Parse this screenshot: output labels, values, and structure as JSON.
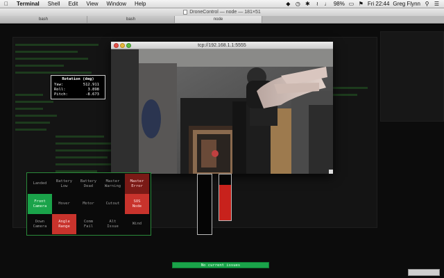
{
  "menubar": {
    "app": "Terminal",
    "items": [
      "Shell",
      "Edit",
      "View",
      "Window",
      "Help"
    ],
    "battery": "98%",
    "clock": "Fri 22:44",
    "user": "Greg Flynn"
  },
  "terminal": {
    "title": "DroneControl — node — 181×51",
    "tabs": [
      "bash",
      "bash",
      "node"
    ],
    "active_tab": 2
  },
  "camera": {
    "window_title": "tcp://192.168.1.1:5555"
  },
  "rotation": {
    "title": "Rotation (deg)",
    "yaw_label": "Yaw:",
    "yaw": "512.911",
    "roll_label": "Roll:",
    "roll": "3.898",
    "pitch_label": "Pitch:",
    "pitch": "-8.673"
  },
  "status_cells": [
    {
      "line1": "Landed",
      "line2": "",
      "state": "off"
    },
    {
      "line1": "Battery",
      "line2": "Low",
      "state": "off"
    },
    {
      "line1": "Battery",
      "line2": "Dead",
      "state": "off"
    },
    {
      "line1": "Master",
      "line2": "Warning",
      "state": "off"
    },
    {
      "line1": "Master",
      "line2": "Error",
      "state": "err-dark"
    },
    {
      "line1": "Front",
      "line2": "Camera",
      "state": "ok"
    },
    {
      "line1": "Hover",
      "line2": "",
      "state": "off"
    },
    {
      "line1": "Motor",
      "line2": "",
      "state": "off"
    },
    {
      "line1": "Cutout",
      "line2": "",
      "state": "off"
    },
    {
      "line1": "SOS",
      "line2": "Node",
      "state": "err"
    },
    {
      "line1": "Down",
      "line2": "Camera",
      "state": "off"
    },
    {
      "line1": "Angle",
      "line2": "Range",
      "state": "err"
    },
    {
      "line1": "Comm",
      "line2": "Fail",
      "state": "off"
    },
    {
      "line1": "Alt",
      "line2": "Issue",
      "state": "off"
    },
    {
      "line1": "Wind",
      "line2": "",
      "state": "off"
    }
  ],
  "throttle": {
    "left_level": 0.0,
    "right_level": 0.78
  },
  "issues_text": "No current issues",
  "colors": {
    "ok": "#1aa34a",
    "error": "#c8332c"
  }
}
